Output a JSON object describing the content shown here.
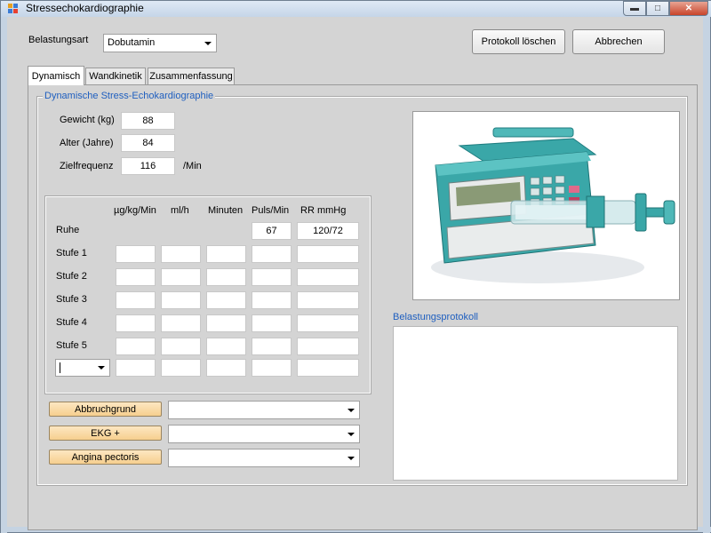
{
  "window": {
    "title": "Stressechokardiographie"
  },
  "header": {
    "belastungsart_label": "Belastungsart",
    "belastungsart_value": "Dobutamin",
    "protokoll_loeschen": "Protokoll löschen",
    "abbrechen": "Abbrechen"
  },
  "tabs": [
    {
      "label": "Dynamisch",
      "active": true
    },
    {
      "label": "Wandkinetik",
      "active": false
    },
    {
      "label": "Zusammenfassung",
      "active": false
    }
  ],
  "group": {
    "title": "Dynamische Stress-Echokardiographie"
  },
  "patient": {
    "gewicht_label": "Gewicht (kg)",
    "gewicht_value": "88",
    "alter_label": "Alter (Jahre)",
    "alter_value": "84",
    "ziel_label": "Zielfrequenz",
    "ziel_value": "116",
    "ziel_unit": "/Min"
  },
  "table": {
    "headers": [
      "µg/kg/Min",
      "ml/h",
      "Minuten",
      "Puls/Min",
      "RR mmHg"
    ],
    "rows": [
      {
        "label": "Ruhe",
        "puls": "67",
        "rr": "120/72"
      },
      {
        "label": "Stufe 1"
      },
      {
        "label": "Stufe 2"
      },
      {
        "label": "Stufe 3"
      },
      {
        "label": "Stufe 4"
      },
      {
        "label": "Stufe 5"
      }
    ]
  },
  "dropdowns": {
    "abbruchgrund": "Abbruchgrund",
    "ekg": "EKG  +",
    "angina": "Angina pectoris"
  },
  "protokoll": {
    "title": "Belastungsprotokoll"
  },
  "colors": {
    "group_title": "#1f5fbf",
    "dd_button": "#f6cf8e",
    "device_body": "#3aa7a8"
  },
  "image": {
    "icon": "infusion-pump-image"
  }
}
